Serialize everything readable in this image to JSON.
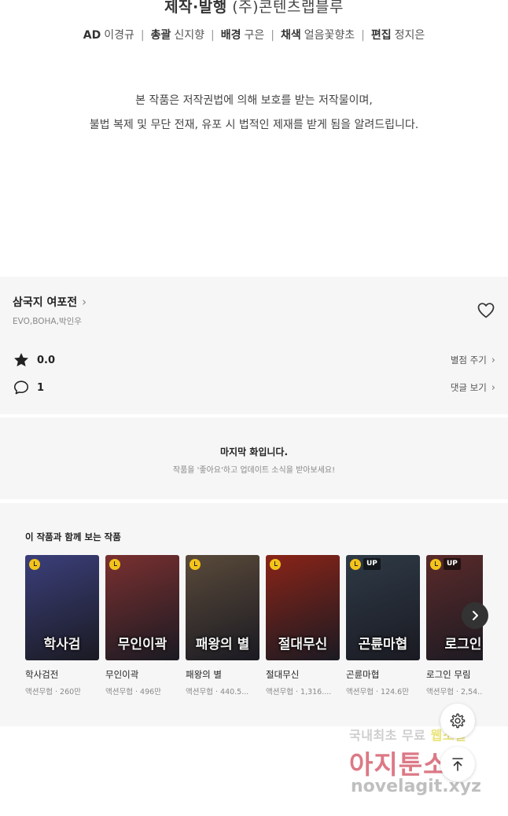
{
  "credits": {
    "production_role": "제작·발행",
    "production_value": "(주)콘텐츠랩블루",
    "staff": [
      {
        "role": "AD",
        "name": "이경규"
      },
      {
        "role": "총괄",
        "name": "신지향"
      },
      {
        "role": "배경",
        "name": "구은"
      },
      {
        "role": "채색",
        "name": "얼음꽃향초"
      },
      {
        "role": "편집",
        "name": "정지은"
      }
    ],
    "separator": "|",
    "notice_line1": "본 작품은 저작권법에 의해 보호를 받는 저작물이며,",
    "notice_line2": "불법 복제 및 무단 전재, 유포 시 법적인 제재를 받게 됨을 알려드립니다."
  },
  "series": {
    "title": "삼국지 여포전",
    "title_chevron": "›",
    "authors": "EVO,BOHA,박인우",
    "favorite_icon": "heart-outline-icon",
    "rating_icon": "star-icon",
    "rating": "0.0",
    "rate_link": "별점 주기",
    "comment_icon": "speech-bubble-icon",
    "comment_count": "1",
    "comments_link": "댓글 보기",
    "link_chevron": "›"
  },
  "last_episode": {
    "title": "마지막 화입니다.",
    "subtitle": "작품을 '좋아요'하고 업데이트 소식을 받아보세요!"
  },
  "recommendations": {
    "heading": "이 작품과 함께 보는 작품",
    "next_icon": "chevron-right-icon",
    "items": [
      {
        "name": "학사검전",
        "meta": "액션무협 · 260만",
        "cover_text": "학사검",
        "up": false,
        "bg": "#3b3f7a"
      },
      {
        "name": "무인이곽",
        "meta": "액션무협 · 496만",
        "cover_text": "무인이곽",
        "up": false,
        "bg": "#7a3030"
      },
      {
        "name": "패왕의 별",
        "meta": "액션무협 · 440.5...",
        "cover_text": "패왕의 별",
        "up": false,
        "bg": "#5a4a3a"
      },
      {
        "name": "절대무신",
        "meta": "액션무협 · 1,316....",
        "cover_text": "절대무신",
        "up": false,
        "bg": "#8a2418"
      },
      {
        "name": "곤륜마협",
        "meta": "액션무협 · 124.6만",
        "cover_text": "곤륜마협",
        "up": true,
        "bg": "#2e3a46"
      },
      {
        "name": "로그인 무림",
        "meta": "액션무협 · 2,54...",
        "cover_text": "로그인",
        "up": true,
        "bg": "#5a2a2a"
      }
    ],
    "up_label": "UP"
  },
  "floating": {
    "settings_icon": "gear-icon",
    "top_icon": "arrow-up-to-top-icon"
  },
  "watermark": {
    "line1_pre": "국내최초 무료 ",
    "line1_hl": "웹소설",
    "line2": "아지툰소설",
    "line3": "novelagit.xyz"
  }
}
